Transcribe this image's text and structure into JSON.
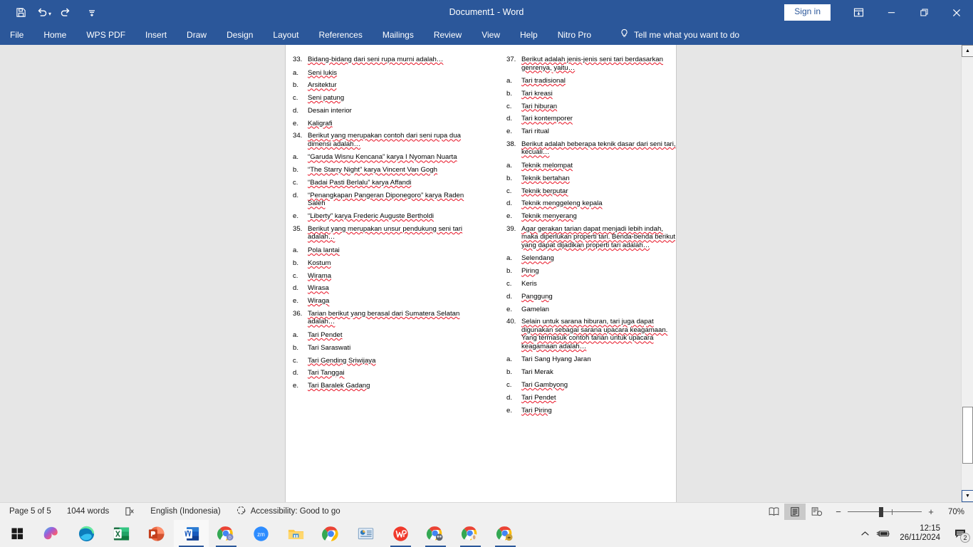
{
  "window": {
    "title": "Document1  -  Word",
    "signin_label": "Sign in",
    "quick_access": [
      {
        "name": "save-icon",
        "label": "Save"
      },
      {
        "name": "undo-icon",
        "label": "Undo"
      },
      {
        "name": "redo-icon",
        "label": "Redo"
      },
      {
        "name": "customize-quick-access-icon",
        "label": "Customize Quick Access Toolbar"
      }
    ],
    "controls": [
      {
        "name": "ribbon-display-options-icon",
        "label": "Ribbon Display Options"
      },
      {
        "name": "minimize-icon",
        "label": "Minimize"
      },
      {
        "name": "restore-icon",
        "label": "Restore Down"
      },
      {
        "name": "close-icon",
        "label": "Close"
      }
    ],
    "accent_color": "#2b579a"
  },
  "ribbon": {
    "tabs": [
      {
        "label": "File",
        "active": false
      },
      {
        "label": "Home",
        "active": false
      },
      {
        "label": "WPS PDF",
        "active": false
      },
      {
        "label": "Insert",
        "active": false
      },
      {
        "label": "Draw",
        "active": false
      },
      {
        "label": "Design",
        "active": false
      },
      {
        "label": "Layout",
        "active": false
      },
      {
        "label": "References",
        "active": false
      },
      {
        "label": "Mailings",
        "active": false
      },
      {
        "label": "Review",
        "active": false
      },
      {
        "label": "View",
        "active": false
      },
      {
        "label": "Help",
        "active": false
      },
      {
        "label": "Nitro Pro",
        "active": false
      }
    ],
    "tell_me": {
      "label": "Tell me what you want to do",
      "icon": "lightbulb-icon"
    },
    "comment_icon": "comment-icon"
  },
  "document": {
    "left_column": [
      {
        "type": "question",
        "marker": "33.",
        "text": "Bidang-bidang dari seni rupa murni adalah…",
        "options": [
          {
            "marker": "a.",
            "text": "Seni lukis"
          },
          {
            "marker": "b.",
            "text": "Arsitektur"
          },
          {
            "marker": "c.",
            "text": "Seni patung"
          },
          {
            "marker": "d.",
            "text": "Desain interior"
          },
          {
            "marker": "e.",
            "text": "Kaligrafi"
          }
        ]
      },
      {
        "type": "question",
        "marker": "34.",
        "text": "Berikut yang merupakan contoh dari seni rupa dua dimensi adalah…",
        "options": [
          {
            "marker": "a.",
            "text": "“Garuda Wisnu Kencana” karya I Nyoman Nuarta"
          },
          {
            "marker": "b.",
            "text": "“The Starry Night” karya Vincent Van Gogh"
          },
          {
            "marker": "c.",
            "text": "“Badai Pasti Berlalu” karya Affandi"
          },
          {
            "marker": "d.",
            "text": "“Penangkapan Pangeran Diponegoro” karya Raden Saleh"
          },
          {
            "marker": "e.",
            "text": "“Liberty” karya Frederic Auguste Bertholdi"
          }
        ]
      },
      {
        "type": "question",
        "marker": "35.",
        "text": "Berikut yang merupakan unsur pendukung seni tari adalah…",
        "options": [
          {
            "marker": "a.",
            "text": "Pola lantai"
          },
          {
            "marker": "b.",
            "text": "Kostum"
          },
          {
            "marker": "c.",
            "text": "Wirama"
          },
          {
            "marker": "d.",
            "text": "Wirasa"
          },
          {
            "marker": "e.",
            "text": "Wiraga"
          }
        ]
      },
      {
        "type": "question",
        "marker": "36.",
        "text": "Tarian berikut yang berasal dari Sumatera Selatan adalah…",
        "options": [
          {
            "marker": "a.",
            "text": "Tari Pendet"
          },
          {
            "marker": "b.",
            "text": "Tari Saraswati"
          },
          {
            "marker": "c.",
            "text": "Tari Gending Sriwijaya"
          },
          {
            "marker": "d.",
            "text": "Tari Tanggai"
          },
          {
            "marker": "e.",
            "text": "Tari Baralek Gadang"
          }
        ]
      }
    ],
    "right_column": [
      {
        "type": "question",
        "marker": "37.",
        "text": "Berikut adalah jenis-jenis seni tari berdasarkan genrenya, yaitu…",
        "options": [
          {
            "marker": "a.",
            "text": "Tari tradisional"
          },
          {
            "marker": "b.",
            "text": "Tari kreasi"
          },
          {
            "marker": "c.",
            "text": "Tari hiburan"
          },
          {
            "marker": "d.",
            "text": "Tari kontemporer"
          },
          {
            "marker": "e.",
            "text": "Tari ritual"
          }
        ]
      },
      {
        "type": "question",
        "marker": "38.",
        "text": "Berikut adalah beberapa teknik dasar dari seni tari, kecuali…",
        "options": [
          {
            "marker": "a.",
            "text": "Teknik melompat"
          },
          {
            "marker": "b.",
            "text": "Teknik bertahan"
          },
          {
            "marker": "c.",
            "text": "Teknik berputar"
          },
          {
            "marker": "d.",
            "text": "Teknik menggeleng kepala"
          },
          {
            "marker": "e.",
            "text": "Teknik menyerang"
          }
        ]
      },
      {
        "type": "question",
        "marker": "39.",
        "text": "Agar gerakan tarian dapat menjadi lebih indah, maka diperlukan properti tari. Benda-benda berikut yang dapat dijadikan properti tari adalah…",
        "options": [
          {
            "marker": "a.",
            "text": "Selendang"
          },
          {
            "marker": "b.",
            "text": "Piring"
          },
          {
            "marker": "c.",
            "text": "Keris"
          },
          {
            "marker": "d.",
            "text": "Panggung"
          },
          {
            "marker": "e.",
            "text": "Gamelan"
          }
        ]
      },
      {
        "type": "question",
        "marker": "40.",
        "text": "Selain untuk sarana hiburan, tari juga dapat digunakan sebagai sarana upacara keagamaan. Yang termasuk contoh tarian untuk upacara keagamaan adalah…",
        "options": [
          {
            "marker": "a.",
            "text": "Tari Sang Hyang Jaran"
          },
          {
            "marker": "b.",
            "text": "Tari Merak"
          },
          {
            "marker": "c.",
            "text": "Tari Gambyong"
          },
          {
            "marker": "d.",
            "text": "Tari Pendet"
          },
          {
            "marker": "e.",
            "text": "Tari Piring"
          }
        ]
      }
    ]
  },
  "status_bar": {
    "page": "Page 5 of 5",
    "words": "1044 words",
    "proofing_icon": "proofing-errors-icon",
    "language": "English (Indonesia)",
    "accessibility_icon": "accessibility-icon",
    "accessibility": "Accessibility: Good to go",
    "views": [
      {
        "name": "read-mode-view-button",
        "selected": false
      },
      {
        "name": "print-layout-view-button",
        "selected": true
      },
      {
        "name": "web-layout-view-button",
        "selected": false
      }
    ],
    "zoom_out_label": "−",
    "zoom_in_label": "+",
    "zoom_level": "70%"
  },
  "taskbar": {
    "start_icon": "windows-start-icon",
    "apps": [
      {
        "name": "taskbar-copilot",
        "label": "Copilot",
        "active": false,
        "running": false
      },
      {
        "name": "taskbar-edge",
        "label": "Microsoft Edge",
        "active": false,
        "running": false
      },
      {
        "name": "taskbar-excel",
        "label": "Excel",
        "active": false,
        "running": false
      },
      {
        "name": "taskbar-powerpoint",
        "label": "PowerPoint",
        "active": false,
        "running": false
      },
      {
        "name": "taskbar-word",
        "label": "Word",
        "active": true,
        "running": true
      },
      {
        "name": "taskbar-chrome-docs",
        "label": "Chrome",
        "active": false,
        "running": true
      },
      {
        "name": "taskbar-zoom",
        "label": "Zoom",
        "active": false,
        "running": false
      },
      {
        "name": "taskbar-file-explorer",
        "label": "File Explorer",
        "active": false,
        "running": false
      },
      {
        "name": "taskbar-chrome",
        "label": "Google Chrome",
        "active": false,
        "running": false
      },
      {
        "name": "taskbar-presentation",
        "label": "Presentation",
        "active": false,
        "running": false
      },
      {
        "name": "taskbar-wps-office",
        "label": "WPS Office",
        "active": false,
        "running": true
      },
      {
        "name": "taskbar-chrome-window-2",
        "label": "Chrome",
        "active": false,
        "running": true
      },
      {
        "name": "taskbar-chrome-window-3",
        "label": "Chrome",
        "active": false,
        "running": true
      },
      {
        "name": "taskbar-chrome-window-4",
        "label": "Chrome",
        "active": false,
        "running": true
      }
    ],
    "tray": {
      "chevron_icon": "show-hidden-icons-chevron",
      "battery_icon": "battery-charging-icon",
      "time": "12:15",
      "date": "26/11/2024",
      "notification_icon": "notifications-icon",
      "notification_count": "2"
    }
  }
}
